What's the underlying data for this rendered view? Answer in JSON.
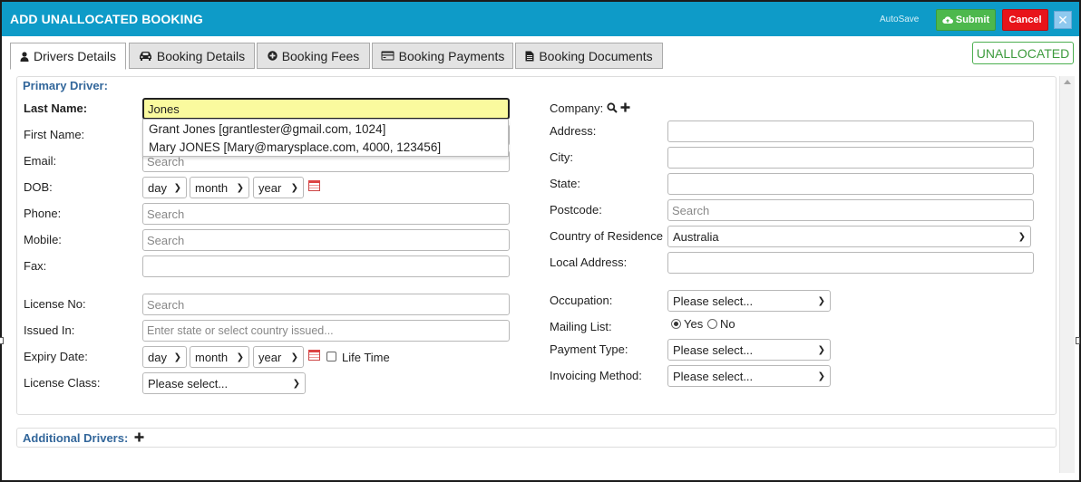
{
  "window": {
    "title": "ADD UNALLOCATED BOOKING",
    "autosave_label": "AutoSave",
    "submit_label": "Submit",
    "cancel_label": "Cancel",
    "close_glyph": "✕",
    "colors": {
      "titlebar": "#0e9bc8",
      "submit": "#4db84d",
      "cancel": "#e8141a",
      "section": "#33679b"
    }
  },
  "tabs": [
    {
      "label": "Drivers Details",
      "icon": "user-icon",
      "active": true
    },
    {
      "label": "Booking Details",
      "icon": "car-icon",
      "active": false
    },
    {
      "label": "Booking Fees",
      "icon": "plus-circle-icon",
      "active": false
    },
    {
      "label": "Booking Payments",
      "icon": "credit-card-icon",
      "active": false
    },
    {
      "label": "Booking Documents",
      "icon": "document-icon",
      "active": false
    }
  ],
  "status": "UNALLOCATED",
  "primary_driver": {
    "section_title": "Primary Driver:",
    "last_name": {
      "label": "Last Name:",
      "value": "Jones"
    },
    "first_name": {
      "label": "First Name:"
    },
    "email": {
      "label": "Email:",
      "placeholder": "Search"
    },
    "dob": {
      "label": "DOB:",
      "day": "day",
      "month": "month",
      "year": "year"
    },
    "phone": {
      "label": "Phone:",
      "placeholder": "Search"
    },
    "mobile": {
      "label": "Mobile:",
      "placeholder": "Search"
    },
    "fax": {
      "label": "Fax:",
      "value": ""
    },
    "license_no": {
      "label": "License No:",
      "placeholder": "Search"
    },
    "issued_in": {
      "label": "Issued In:",
      "placeholder": "Enter state or select country issued..."
    },
    "expiry": {
      "label": "Expiry Date:",
      "day": "day",
      "month": "month",
      "year": "year",
      "lifetime_label": "Life Time"
    },
    "license_class": {
      "label": "License Class:",
      "value": "Please select..."
    },
    "autocomplete": [
      "Grant Jones [grantlester@gmail.com, 1024]",
      "Mary JONES [Mary@marysplace.com, 4000, 123456]"
    ]
  },
  "right_col": {
    "company": {
      "label": "Company:"
    },
    "address": {
      "label": "Address:",
      "value": ""
    },
    "city": {
      "label": "City:",
      "value": ""
    },
    "state": {
      "label": "State:",
      "value": ""
    },
    "postcode": {
      "label": "Postcode:",
      "placeholder": "Search"
    },
    "country": {
      "label": "Country of Residence",
      "value": "Australia"
    },
    "local_address": {
      "label": "Local Address:",
      "value": ""
    },
    "occupation": {
      "label": "Occupation:",
      "value": "Please select..."
    },
    "mailing_list": {
      "label": "Mailing List:",
      "yes": "Yes",
      "no": "No",
      "selected": "Yes"
    },
    "payment_type": {
      "label": "Payment Type:",
      "value": "Please select..."
    },
    "invoicing_method": {
      "label": "Invoicing Method:",
      "value": "Please select..."
    }
  },
  "additional_drivers": {
    "section_title": "Additional Drivers:"
  }
}
